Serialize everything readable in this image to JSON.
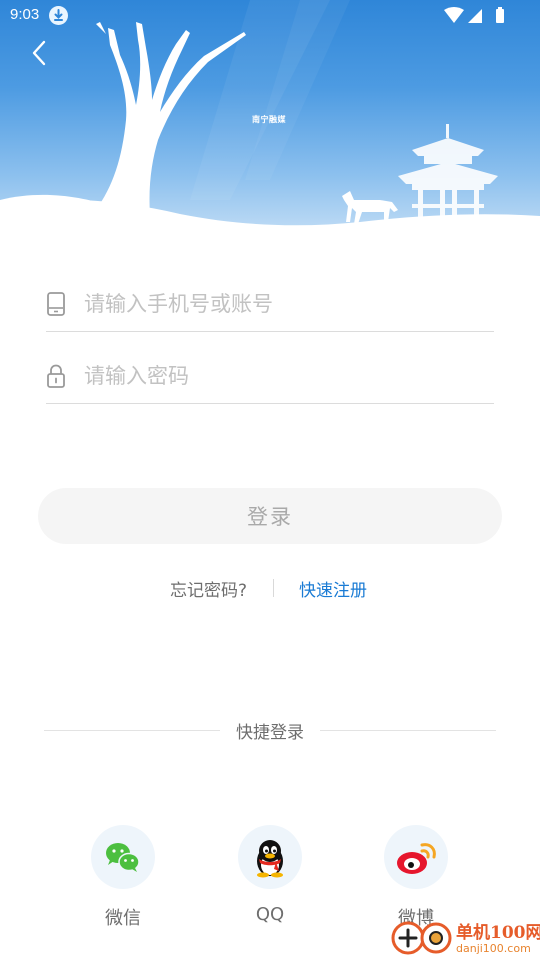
{
  "status_bar": {
    "time": "9:03",
    "icons": [
      "download-icon",
      "wifi-icon",
      "signal-icon",
      "battery-icon"
    ]
  },
  "header": {
    "back_icon": "chevron-left-icon",
    "brand": "南宁融媒"
  },
  "login_form": {
    "account": {
      "icon": "phone-icon",
      "placeholder": "请输入手机号或账号",
      "value": ""
    },
    "password": {
      "icon": "lock-icon",
      "placeholder": "请输入密码",
      "value": ""
    },
    "submit_label": "登录"
  },
  "links": {
    "forgot": "忘记密码?",
    "register": "快速注册"
  },
  "quick_login": {
    "title": "快捷登录",
    "providers": [
      {
        "label": "微信",
        "icon": "wechat-icon"
      },
      {
        "label": "QQ",
        "icon": "qq-icon"
      },
      {
        "label": "微博",
        "icon": "weibo-icon"
      }
    ]
  },
  "watermark": {
    "name": "单机100网",
    "url": "danji100.com"
  },
  "colors": {
    "accent": "#1a7bd4",
    "hero_top": "#2f86d8",
    "button_bg": "#f5f5f5",
    "watermark": "#e65c2a"
  }
}
